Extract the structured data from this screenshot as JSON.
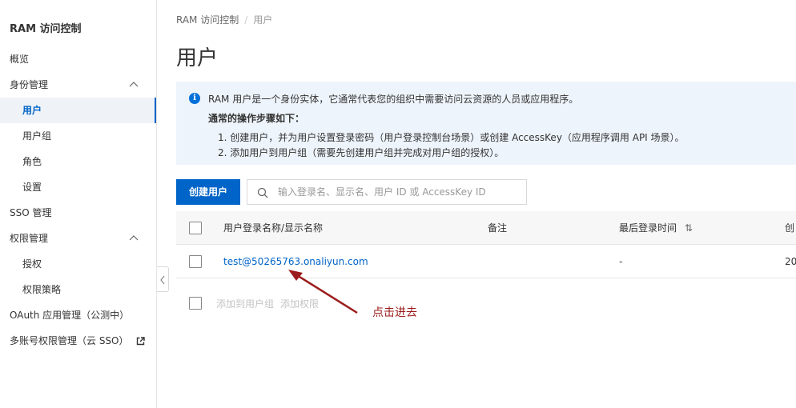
{
  "sidebar": {
    "title": "RAM 访问控制",
    "items": [
      {
        "label": "概览"
      },
      {
        "label": "身份管理"
      },
      {
        "label": "用户"
      },
      {
        "label": "用户组"
      },
      {
        "label": "角色"
      },
      {
        "label": "设置"
      },
      {
        "label": "SSO 管理"
      },
      {
        "label": "权限管理"
      },
      {
        "label": "授权"
      },
      {
        "label": "权限策略"
      },
      {
        "label": "OAuth 应用管理（公测中）"
      },
      {
        "label": "多账号权限管理（云 SSO）"
      }
    ]
  },
  "breadcrumb": {
    "root": "RAM 访问控制",
    "sep": "/",
    "current": "用户"
  },
  "page": {
    "title": "用户"
  },
  "info": {
    "line1": "RAM 用户是一个身份实体，它通常代表您的组织中需要访问云资源的人员或应用程序。",
    "line2": "通常的操作步骤如下：",
    "line3": "1. 创建用户，并为用户设置登录密码（用户登录控制台场景）或创建 AccessKey（应用程序调用 API 场景）。",
    "line4": "2. 添加用户到用户组（需要先创建用户组并完成对用户组的授权）。"
  },
  "toolbar": {
    "create_label": "创建用户",
    "search_placeholder": "输入登录名、显示名、用户 ID 或 AccessKey ID"
  },
  "table": {
    "headers": [
      "用户登录名称/显示名称",
      "备注",
      "最后登录时间",
      "创"
    ],
    "sort_icon": "⇅",
    "rows": [
      {
        "login": "test@50265763.onaliyun.com",
        "remark": "",
        "last_login": "-",
        "created": "20"
      }
    ]
  },
  "batch": {
    "add_group": "添加到用户组",
    "add_permission": "添加权限"
  },
  "annotation": {
    "text": "点击进去",
    "color": "#9b1c1c"
  },
  "colors": {
    "accent": "#0064c8",
    "info_bg": "#eef4fb",
    "active_bg": "#eff3f8"
  }
}
